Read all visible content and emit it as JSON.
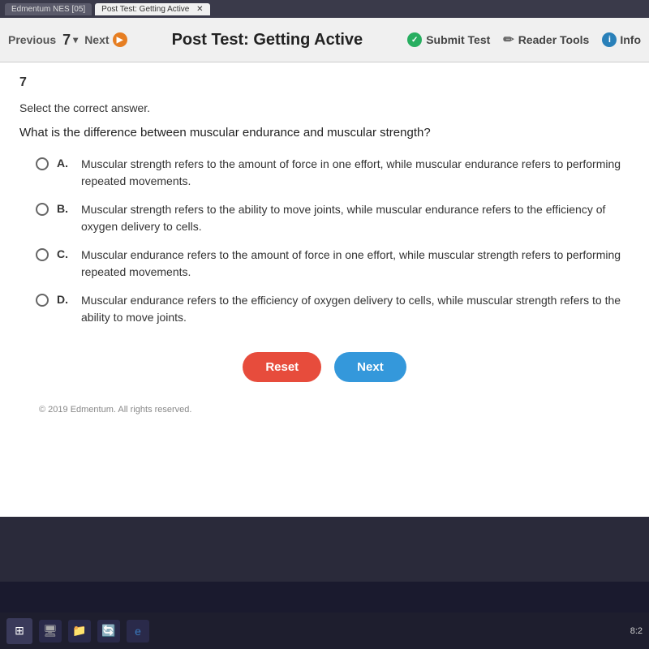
{
  "browser": {
    "tabs": [
      {
        "label": "Edmentum NES [05]",
        "active": false
      },
      {
        "label": "Post Test: Getting Active",
        "active": true
      }
    ]
  },
  "navbar": {
    "prev_label": "Previous",
    "question_number": "7",
    "dropdown_symbol": "▾",
    "next_label": "Next",
    "title": "Post Test: Getting Active",
    "submit_label": "Submit Test",
    "reader_label": "Reader Tools",
    "info_label": "Info"
  },
  "question": {
    "number": "7",
    "instructions": "Select the correct answer.",
    "text": "What is the difference between muscular endurance and muscular strength?",
    "options": [
      {
        "letter": "A.",
        "text": "Muscular strength refers to the amount of force in one effort, while muscular endurance refers to performing repeated movements."
      },
      {
        "letter": "B.",
        "text": "Muscular strength refers to the ability to move joints, while muscular endurance refers to the efficiency of oxygen delivery to cells."
      },
      {
        "letter": "C.",
        "text": "Muscular endurance refers to the amount of force in one effort, while muscular strength refers to performing repeated movements."
      },
      {
        "letter": "D.",
        "text": "Muscular endurance refers to the efficiency of oxygen delivery to cells, while muscular strength refers to the ability to move joints."
      }
    ]
  },
  "buttons": {
    "reset_label": "Reset",
    "next_label": "Next"
  },
  "footer": {
    "copyright": "© 2019 Edmentum. All rights reserved."
  },
  "taskbar": {
    "time": "8:2"
  }
}
